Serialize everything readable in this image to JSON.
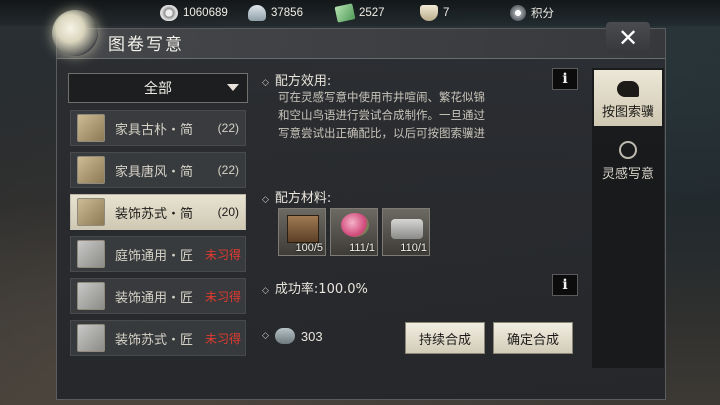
{
  "currencies": [
    {
      "icon": "film-reel-icon",
      "value": "1060689"
    },
    {
      "icon": "ingot-icon",
      "value": "37856"
    },
    {
      "icon": "banknote-icon",
      "value": "2527"
    },
    {
      "icon": "bowl-icon",
      "value": "7"
    },
    {
      "icon": "badge-icon",
      "value": "积分"
    }
  ],
  "panel": {
    "title": "图卷写意"
  },
  "filter": {
    "selected": "全部"
  },
  "list": [
    {
      "name": "家具古朴・简",
      "count": "(22)",
      "locked": ""
    },
    {
      "name": "家具唐风・简",
      "count": "(22)",
      "locked": ""
    },
    {
      "name": "装饰苏式・简",
      "count": "(20)",
      "locked": ""
    },
    {
      "name": "庭饰通用・匠",
      "count": "",
      "locked": "未习得"
    },
    {
      "name": "装饰通用・匠",
      "count": "",
      "locked": "未习得"
    },
    {
      "name": "装饰苏式・匠",
      "count": "",
      "locked": "未习得"
    }
  ],
  "detail": {
    "effect_title": "配方效用:",
    "effect_lines": [
      "可在灵感写意中使用市井喧闹、繁花似锦",
      "和空山鸟语进行尝试合成制作。一旦通过",
      "写意尝试出正确配比，以后可按图索骥进"
    ],
    "materials_title": "配方材料:",
    "materials": [
      {
        "icon": "cabinet-icon",
        "qty": "100/5"
      },
      {
        "icon": "flower-vase-icon",
        "qty": "111/1"
      },
      {
        "icon": "stone-ornament-icon",
        "qty": "110/1"
      }
    ],
    "success_rate": "成功率:100.0%",
    "cost_value": "303",
    "continue_label": "持续合成",
    "confirm_label": "确定合成"
  },
  "tabs": [
    {
      "label": "按图索骥",
      "active": true
    },
    {
      "label": "灵感写意",
      "active": false
    }
  ]
}
